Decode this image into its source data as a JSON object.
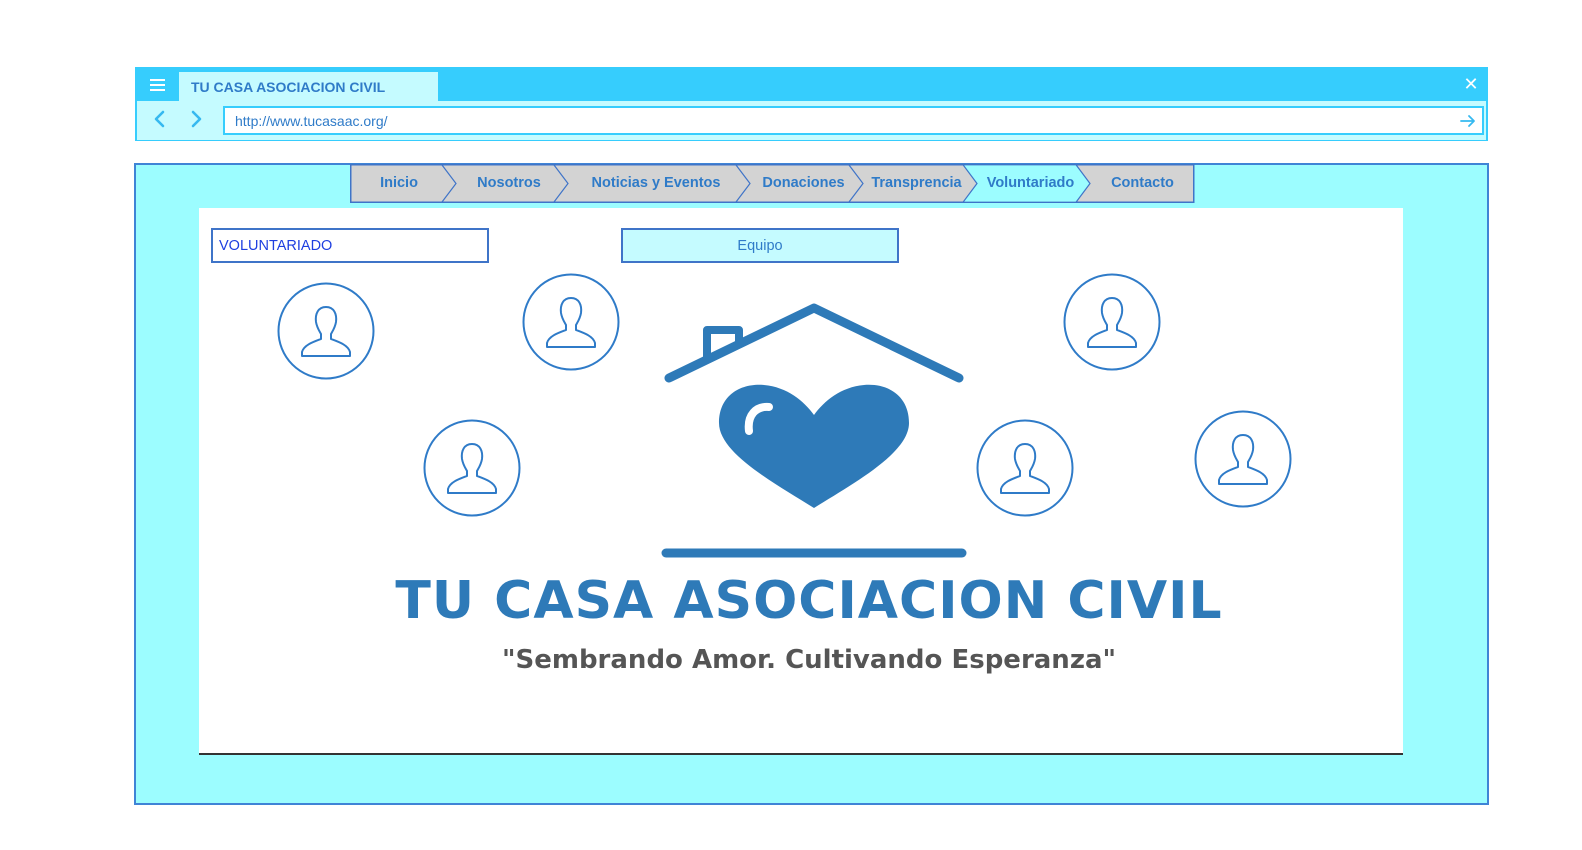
{
  "browser": {
    "tab_title": "TU CASA ASOCIACION CIVIL",
    "url": "http://www.tucasaac.org/",
    "menu_icon": "hamburger-icon",
    "close_icon": "close-icon",
    "back_icon": "chevron-left-icon",
    "forward_icon": "chevron-right-icon",
    "go_icon": "arrow-right-icon"
  },
  "nav": {
    "items": [
      "Inicio",
      "Nosotros",
      "Noticias y Eventos",
      "Donaciones",
      "Transprencia",
      "Voluntariado",
      "Contacto"
    ],
    "active": "Voluntariado"
  },
  "content": {
    "section_title": "VOLUNTARIADO",
    "team_button": "Equipo",
    "avatar_icon": "user-avatar-icon"
  },
  "logo": {
    "title": "TU CASA ASOCIACION CIVIL",
    "tagline": "\"Sembrando Amor. Cultivando Esperanza\""
  },
  "colors": {
    "chrome": "#36cdfd",
    "tab_bg": "#c5fbff",
    "page_bg": "#9cfdff",
    "accent": "#2f7bc8",
    "logo_blue": "#2e7ab8"
  }
}
